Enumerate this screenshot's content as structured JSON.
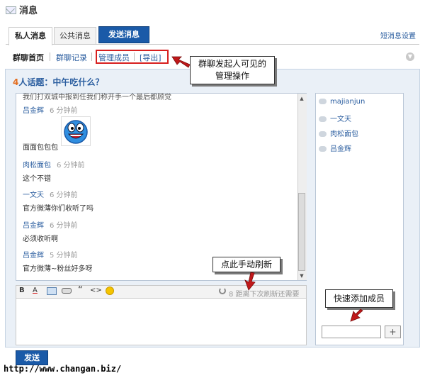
{
  "header": {
    "title": "消息"
  },
  "tabs": [
    {
      "label": "私人消息"
    },
    {
      "label": "公共消息"
    },
    {
      "label": "发送消息"
    }
  ],
  "settings_link": "短消息设置",
  "subnav": {
    "home": "群聊首页",
    "records": "群聊记录",
    "manage": "管理成员",
    "export": "[导出]"
  },
  "topic": {
    "count": "4",
    "label": "人话题：中午吃什么？"
  },
  "chat": {
    "clipped_text": "我们打双城中报到任我们称开手一个最后都顾觉",
    "messages": [
      {
        "name": "吕金辉",
        "time": "6 分钟前",
        "text": "面面包包包"
      },
      {
        "name": "肉松面包",
        "time": "6 分钟前",
        "text": "这个不错"
      },
      {
        "name": "一文天",
        "time": "6 分钟前",
        "text": "官方微薄你们收听了吗"
      },
      {
        "name": "吕金辉",
        "time": "6 分钟前",
        "text": "必须收听啊"
      },
      {
        "name": "吕金辉",
        "time": "5 分钟前",
        "text": "官方微薄~粉丝好多呀"
      }
    ]
  },
  "toolbar": {
    "bold": "B",
    "underline": "A",
    "quote": "“",
    "code": "<>",
    "refresh_count": "8",
    "refresh_text": "距离下次刷新还需要"
  },
  "members": [
    "majianjun",
    "一文天",
    "肉松面包",
    "吕金辉"
  ],
  "add_member": {
    "button": "+"
  },
  "send_button": "发送",
  "callouts": {
    "admin": "群聊发起人可见的\n管理操作",
    "refresh": "点此手动刷新",
    "add_member": "快速添加成员"
  },
  "watermark": "http://www.changan.biz/",
  "colors": {
    "accent": "#1a5aa8",
    "link": "#2a5d9f",
    "highlight": "#d71f1f",
    "topic_count": "#e36d1f"
  }
}
